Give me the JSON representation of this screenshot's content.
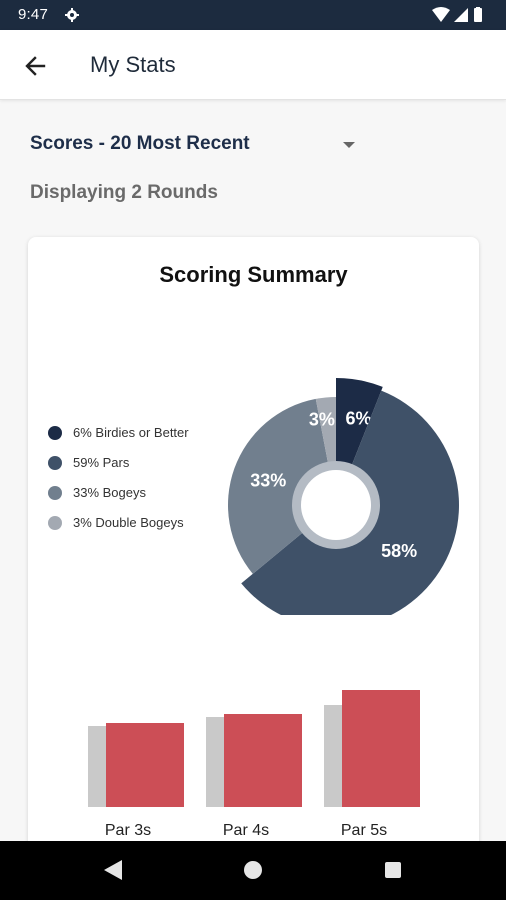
{
  "status_bar": {
    "time": "9:47",
    "icons": [
      "gear-icon",
      "wifi-icon",
      "cell-signal-icon",
      "battery-icon"
    ]
  },
  "app_bar": {
    "title": "My Stats",
    "back_icon": "arrow-left-icon"
  },
  "filter": {
    "label": "Scores - 20 Most Recent",
    "caret_icon": "dropdown-caret-icon"
  },
  "display_count": "Displaying 2 Rounds",
  "card": {
    "title": "Scoring Summary"
  },
  "chart_data": [
    {
      "type": "pie",
      "labels": [
        "Birdies or Better",
        "Pars",
        "Bogeys",
        "Double Bogeys"
      ],
      "values": [
        6,
        58,
        33,
        3
      ],
      "legend": [
        {
          "text": "6% Birdies or Better",
          "color": "#1c2b46"
        },
        {
          "text": "59% Pars",
          "color": "#3f5168"
        },
        {
          "text": "33% Bogeys",
          "color": "#717f8e"
        },
        {
          "text": "3% Double Bogeys",
          "color": "#a3a9b2"
        }
      ],
      "slice_labels": [
        "6%",
        "58%",
        "33%",
        "3%"
      ],
      "colors": [
        "#1c2b46",
        "#3f5168",
        "#717f8e",
        "#a3a9b2"
      ],
      "legend_position": "left"
    },
    {
      "type": "bar",
      "categories": [
        "Par 3s",
        "Par 4s",
        "Par 5s"
      ],
      "series": [
        {
          "values": [
            3.4,
            3.7,
            4.1
          ],
          "color": "#c9c9c9"
        },
        {
          "values": [
            3.5,
            3.8,
            4.6
          ],
          "color": "#cc4e56"
        }
      ]
    }
  ],
  "nav_bar": {
    "icons": [
      "nav-back-icon",
      "nav-home-icon",
      "nav-recents-icon"
    ]
  }
}
